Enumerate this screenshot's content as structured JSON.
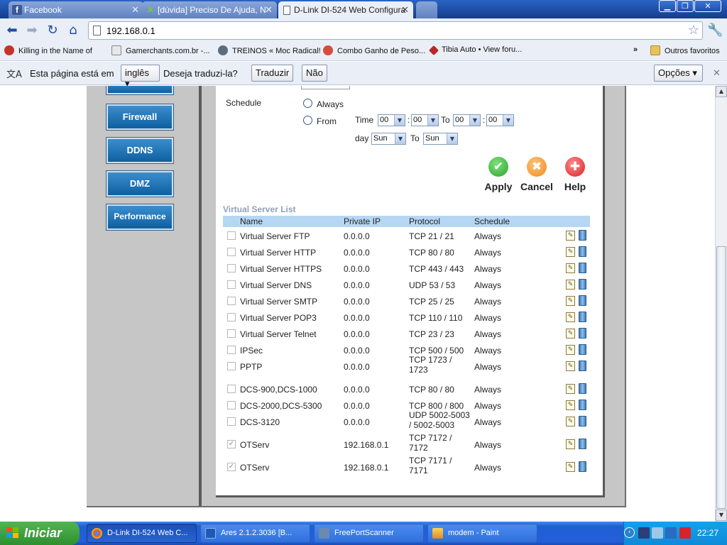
{
  "browser": {
    "tabs": [
      {
        "title": "Facebook",
        "icon": "facebook-icon"
      },
      {
        "title": "[dúvida] Preciso De Ajuda, N",
        "icon": "site-icon"
      },
      {
        "title": "D-Link DI-524 Web Configura",
        "icon": "page-icon"
      }
    ],
    "address": "192.168.0.1",
    "bookmarks": [
      "Killing in the Name of",
      "Gamerchants.com.br -...",
      "TREINOS « Moc Radical!",
      "Combo Ganho de Peso...",
      "Tibia Auto • View foru..."
    ],
    "bookmarks_more": "»",
    "other_bookmarks": "Outros favoritos"
  },
  "translate_bar": {
    "text_before": "Esta página está em",
    "language": "inglês",
    "text_after": "Deseja traduzi-la?",
    "translate_button": "Traduzir",
    "no_button": "Não",
    "options_button": "Opções",
    "close": "✕"
  },
  "sidebar": {
    "buttons": [
      "Firewall",
      "DDNS",
      "DMZ",
      "Performance"
    ]
  },
  "schedule": {
    "label": "Schedule",
    "always": "Always",
    "from": "From",
    "time_label": "Time",
    "to_label": "To",
    "day_label": "day",
    "start_hour": "00",
    "start_min": "00",
    "end_hour": "00",
    "end_min": "00",
    "colon": ":",
    "start_day": "Sun",
    "end_day": "Sun"
  },
  "actions": {
    "apply": "Apply",
    "cancel": "Cancel",
    "help": "Help"
  },
  "vs_list": {
    "title": "Virtual Server List",
    "headers": [
      "Name",
      "Private IP",
      "Protocol",
      "Schedule"
    ],
    "rows": [
      {
        "checked": false,
        "name": "Virtual Server FTP",
        "ip": "0.0.0.0",
        "proto1": "TCP 21 / 21",
        "proto2": "",
        "schedule": "Always"
      },
      {
        "checked": false,
        "name": "Virtual Server HTTP",
        "ip": "0.0.0.0",
        "proto1": "TCP 80 / 80",
        "proto2": "",
        "schedule": "Always"
      },
      {
        "checked": false,
        "name": "Virtual Server HTTPS",
        "ip": "0.0.0.0",
        "proto1": "TCP 443 / 443",
        "proto2": "",
        "schedule": "Always"
      },
      {
        "checked": false,
        "name": "Virtual Server DNS",
        "ip": "0.0.0.0",
        "proto1": "UDP 53 / 53",
        "proto2": "",
        "schedule": "Always"
      },
      {
        "checked": false,
        "name": "Virtual Server SMTP",
        "ip": "0.0.0.0",
        "proto1": "TCP 25 / 25",
        "proto2": "",
        "schedule": "Always"
      },
      {
        "checked": false,
        "name": "Virtual Server POP3",
        "ip": "0.0.0.0",
        "proto1": "TCP 110 / 110",
        "proto2": "",
        "schedule": "Always"
      },
      {
        "checked": false,
        "name": "Virtual Server Telnet",
        "ip": "0.0.0.0",
        "proto1": "TCP 23 / 23",
        "proto2": "",
        "schedule": "Always"
      },
      {
        "checked": false,
        "name": "IPSec",
        "ip": "0.0.0.0",
        "proto1": "TCP 500 / 500",
        "proto2": "",
        "schedule": "Always"
      },
      {
        "checked": false,
        "name": "PPTP",
        "ip": "0.0.0.0",
        "proto1": "TCP 1723 /",
        "proto2": "1723",
        "schedule": "Always"
      },
      {
        "checked": false,
        "name": "DCS-900,DCS-1000",
        "ip": "0.0.0.0",
        "proto1": "TCP 80 / 80",
        "proto2": "",
        "schedule": "Always"
      },
      {
        "checked": false,
        "name": "DCS-2000,DCS-5300",
        "ip": "0.0.0.0",
        "proto1": "TCP 800 / 800",
        "proto2": "",
        "schedule": "Always"
      },
      {
        "checked": false,
        "name": "DCS-3120",
        "ip": "0.0.0.0",
        "proto1": "UDP 5002-5003",
        "proto2": "/ 5002-5003",
        "schedule": "Always"
      },
      {
        "checked": true,
        "name": "OTServ",
        "ip": "192.168.0.1",
        "proto1": "TCP 7172 /",
        "proto2": "7172",
        "schedule": "Always"
      },
      {
        "checked": true,
        "name": "OTServ",
        "ip": "192.168.0.1",
        "proto1": "TCP 7171 /",
        "proto2": "7171",
        "schedule": "Always"
      }
    ]
  },
  "taskbar": {
    "start": "Iniciar",
    "tasks": [
      "D-Link DI-524 Web C...",
      "Ares 2.1.2.3036   [B...",
      "FreePortScanner",
      "modem - Paint"
    ],
    "clock": "22:27"
  },
  "colors": {
    "accent": "#2a63c4",
    "list_header": "#b6d7f4",
    "sidebar_button": "#1a6fb3",
    "apply_green": "#2aa52a",
    "cancel_orange": "#f08a1c",
    "help_red": "#d8232a"
  }
}
